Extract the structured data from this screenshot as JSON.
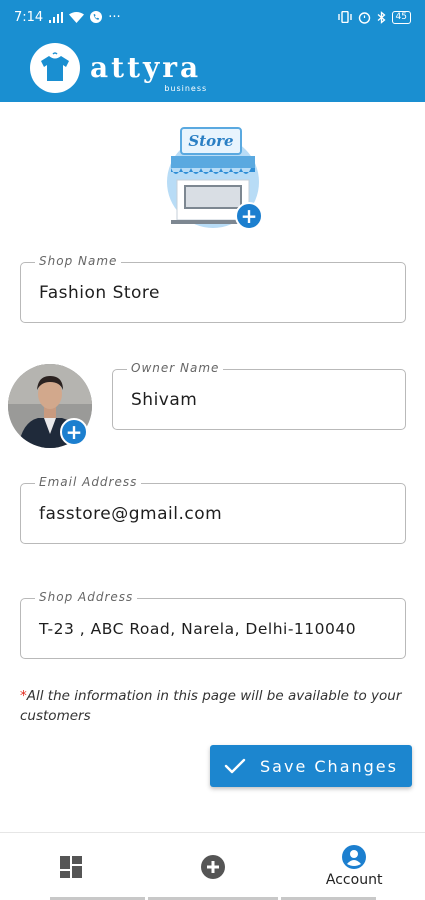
{
  "status_bar": {
    "time": "7:14",
    "battery": "45"
  },
  "header": {
    "brand_name": "attyra",
    "brand_sub": "business"
  },
  "store_badge_text": "Store",
  "fields": {
    "shop_name": {
      "label": "Shop Name",
      "value": "Fashion Store"
    },
    "owner_name": {
      "label": "Owner Name",
      "value": "Shivam"
    },
    "email": {
      "label": "Email Address",
      "value": "fasstore@gmail.com"
    },
    "shop_address": {
      "label": "Shop Address",
      "value": "T-23 , ABC Road, Narela, Delhi-110040"
    }
  },
  "note": {
    "marker": "*",
    "text": "All the information in this page will be available to your customers"
  },
  "save_button": {
    "label": "Save Changes"
  },
  "bottom_nav": {
    "items": [
      {
        "label": "",
        "icon": "dashboard-icon"
      },
      {
        "label": "",
        "icon": "add-circle-icon"
      },
      {
        "label": "Account",
        "icon": "account-icon"
      }
    ],
    "active_index": 2
  },
  "colors": {
    "primary": "#1a8fd1",
    "button": "#1c86cf",
    "required": "#e0281c"
  }
}
